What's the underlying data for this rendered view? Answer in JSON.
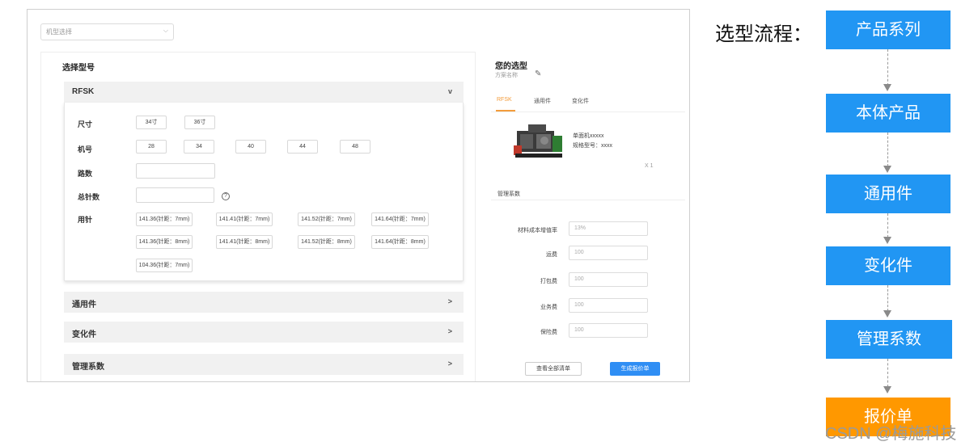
{
  "screenshot": {
    "model_select_placeholder": "机型选择",
    "left": {
      "section_title": "选择型号",
      "rfsk": {
        "header": "RFSK",
        "arrow": "v",
        "size_label": "尺寸",
        "sizes": [
          "34寸",
          "36寸"
        ],
        "machine_label": "机号",
        "machines": [
          "28",
          "34",
          "40",
          "44",
          "48"
        ],
        "lanes_label": "路数",
        "total_needles_label": "总针数",
        "help": "?",
        "needles_label": "用针",
        "needles": [
          "141.36(针距：7mm)",
          "141.41(针距：7mm)",
          "141.52(针距：7mm)",
          "141.64(针距：7mm)",
          "141.36(针距：8mm)",
          "141.41(针距：8mm)",
          "141.52(针距：8mm)",
          "141.64(针距：8mm)",
          "104.36(针距：7mm)"
        ]
      },
      "collapsed": [
        {
          "label": "通用件",
          "arrow": ">"
        },
        {
          "label": "变化件",
          "arrow": ">"
        },
        {
          "label": "管理系数",
          "arrow": ">"
        }
      ]
    },
    "right": {
      "title": "您的选型",
      "subtitle": "方案名称",
      "tabs": [
        "RFSK",
        "通用件",
        "变化件"
      ],
      "active_tab": "RFSK",
      "product_name": "单面机xxxxx",
      "product_spec": "规格型号：xxxx",
      "quantity": "X 1",
      "mgmt_title": "管理系数",
      "fields": [
        {
          "label": "材料成本增值率",
          "placeholder": "13%"
        },
        {
          "label": "运费",
          "placeholder": "100"
        },
        {
          "label": "打包费",
          "placeholder": "100"
        },
        {
          "label": "业务费",
          "placeholder": "100"
        },
        {
          "label": "保险费",
          "placeholder": "100"
        }
      ],
      "view_all_button": "查看全部清单",
      "generate_button": "生成报价单"
    }
  },
  "flow": {
    "title": "选型流程：",
    "steps": [
      "产品系列",
      "本体产品",
      "通用件",
      "变化件",
      "管理系数",
      "报价单"
    ]
  },
  "watermark": "CSDN @梅施科技",
  "colors": {
    "flow_blue": "#2196f3",
    "flow_orange": "#ff9800",
    "primary_button": "#2f8ef4",
    "active_tab": "#f39c3c"
  }
}
